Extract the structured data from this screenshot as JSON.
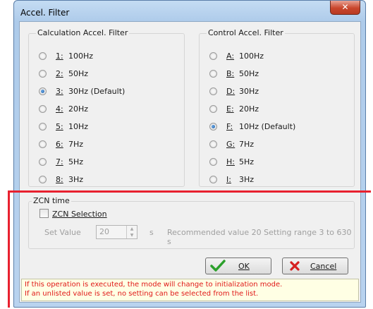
{
  "window": {
    "title": "Accel. Filter",
    "close_glyph": "✕"
  },
  "calc_filter": {
    "title": "Calculation Accel. Filter",
    "selected_index": 2,
    "options": [
      {
        "key": "1:",
        "label": "100Hz"
      },
      {
        "key": "2:",
        "label": "50Hz"
      },
      {
        "key": "3:",
        "label": "30Hz (Default)"
      },
      {
        "key": "4:",
        "label": "20Hz"
      },
      {
        "key": "5:",
        "label": "10Hz"
      },
      {
        "key": "6:",
        "label": "7Hz"
      },
      {
        "key": "7:",
        "label": "5Hz"
      },
      {
        "key": "8:",
        "label": "3Hz"
      }
    ]
  },
  "control_filter": {
    "title": "Control Accel. Filter",
    "selected_index": 4,
    "options": [
      {
        "key": "A:",
        "label": "100Hz"
      },
      {
        "key": "B:",
        "label": "50Hz"
      },
      {
        "key": "D:",
        "label": "30Hz"
      },
      {
        "key": "E:",
        "label": "20Hz"
      },
      {
        "key": "F:",
        "label": "10Hz (Default)"
      },
      {
        "key": "G:",
        "label": "7Hz"
      },
      {
        "key": "H:",
        "label": "5Hz"
      },
      {
        "key": "I:",
        "label": "3Hz"
      }
    ]
  },
  "zcn": {
    "title": "ZCN time",
    "checkbox_label": "ZCN Selection",
    "checked": false,
    "set_value_label": "Set Value",
    "set_value": "20",
    "unit": "s",
    "recommendation": "Recommended value 20  Setting range 3 to 630 s"
  },
  "buttons": {
    "ok_label": "OK",
    "cancel_label": "Cancel"
  },
  "messages": {
    "line1": "If this operation is executed, the mode will change to initialization mode.",
    "line2": "If an unlisted value is set, no setting can be selected from the list."
  },
  "colors": {
    "message_text": "#e01818",
    "annotation": "#e8212f",
    "ok_icon": "#2ca02c",
    "cancel_icon": "#d62020"
  }
}
